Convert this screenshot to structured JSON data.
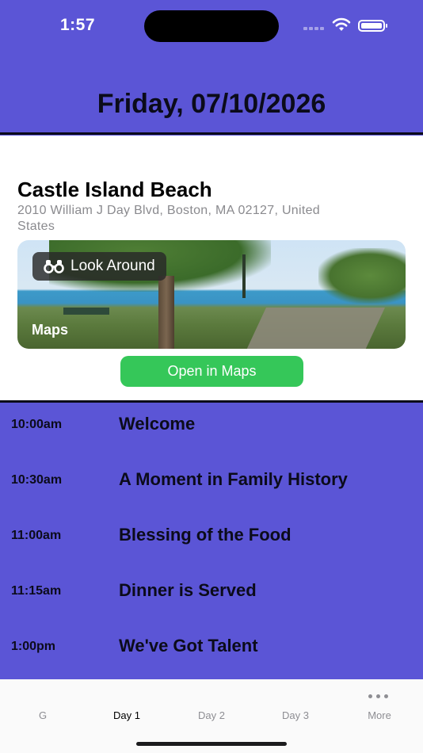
{
  "status_bar": {
    "time": "1:57"
  },
  "header": {
    "date": "Friday, 07/10/2026"
  },
  "location": {
    "name": "Castle Island Beach",
    "address": "2010 William J Day Blvd, Boston, MA  02127, United States",
    "look_around_label": "Look Around",
    "maps_label": "Maps",
    "open_button": "Open in Maps",
    "button_color": "#35c759"
  },
  "schedule": [
    {
      "time": "10:00am",
      "title": "Welcome"
    },
    {
      "time": "10:30am",
      "title": "A Moment in Family History"
    },
    {
      "time": "11:00am",
      "title": "Blessing of the Food"
    },
    {
      "time": "11:15am",
      "title": "Dinner is Served"
    },
    {
      "time": "1:00pm",
      "title": "We've Got Talent"
    }
  ],
  "tabs": [
    {
      "label": "G"
    },
    {
      "label": "Day 1"
    },
    {
      "label": "Day 2"
    },
    {
      "label": "Day 3"
    },
    {
      "label": "More"
    }
  ],
  "colors": {
    "accent_background": "#5b55d6"
  }
}
